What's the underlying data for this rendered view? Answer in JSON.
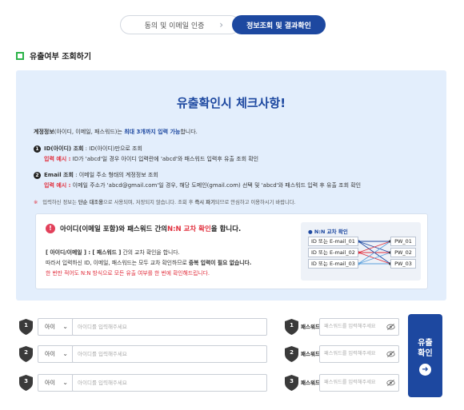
{
  "steps": {
    "step1_label": "동의 및 이메일 인증",
    "step2_label": "정보조회 및 결과확인"
  },
  "section": {
    "title": "유출여부 조회하기"
  },
  "panel": {
    "title": "유출확인시 체크사항!",
    "account_line": {
      "prefix": "계정정보",
      "mid": "(아이디, 이메일, 패스워드)는 ",
      "highlight": "최대 3개까지 입력 가능",
      "suffix": "합니다."
    },
    "id_lookup": {
      "num": "1",
      "title": "ID(아이디) 조회",
      "desc": " : ID(아이디)만으로 조회",
      "example_label": "입력 예시 :",
      "example_text": " ID가 'abcd'일 경우 아이디 입력란에 'abcd'와 패스워드 입력후 유출 조회 확인"
    },
    "email_lookup": {
      "num": "2",
      "title": "Email 조회",
      "desc": " : 이메일 주소 형태의 계정정보 조회",
      "example_label": "입력 예시 :",
      "example_text": " 이메일 주소가 'abcd@gmail.com'일 경우, 해당 도메인(gmail.com) 선택 및 'abcd'와 패스워드 입력 후 유출 조회 확인"
    },
    "notice": {
      "mark": "※",
      "text1": " 입력하신 정보는 ",
      "bold1": "단순 대조용",
      "text2": "으로 사용되며, 저장되지 않습니다. 조회 후 ",
      "bold2": "즉시 파기",
      "text3": "되므로 안심하고 이용하시기 바랍니다."
    },
    "cross": {
      "icon": "!",
      "head_a": "아이디(이메일 포함)",
      "head_b": "와 패스워드 간의 ",
      "head_red": "N:N 교차 확인",
      "head_c": "을 합니다.",
      "line1": "[ 아이디/이메일 ] : [ 패스워드 ]",
      "line1_tail": " 간의 교차 확인을 합니다.",
      "line2_a": "따라서 입력하신 ID, 이메일, 패스워드는 모두 교차 확인하므로 ",
      "line2_b": "중복 입력이 필요 없습니다.",
      "line3": "한 번만 적어도 N:N 방식으로 모든 유출 여부를 한 번에 확인해드립니다."
    },
    "diagram": {
      "title": "● N:N 교차 확인",
      "ids": [
        "ID 또는 E-mail_01",
        "ID 또는 E-mail_02",
        "ID 또는 E-mail_03"
      ],
      "pws": [
        "PW_01",
        "PW_02",
        "PW_03"
      ]
    }
  },
  "rows": [
    {
      "num": "1",
      "domain": "아이",
      "id_placeholder": "아이디를 입력해주세요",
      "pw_label": "패스워드",
      "pw_placeholder": "패스워드를 입력해주세요"
    },
    {
      "num": "2",
      "domain": "아이",
      "id_placeholder": "아이디를 입력해주세요",
      "pw_label": "패스워드",
      "pw_placeholder": "패스워드를 입력해주세요"
    },
    {
      "num": "3",
      "domain": "아이",
      "id_placeholder": "아이디를 입력해주세요",
      "pw_label": "패스워드",
      "pw_placeholder": "패스워드를 입력해주세요"
    }
  ],
  "submit": {
    "line1": "유출",
    "line2": "확인",
    "arrow": "➜"
  },
  "colors": {
    "primary": "#1d48a0",
    "accent_red": "#e12e3c",
    "panel_bg": "#e3eefc",
    "green": "#2db34a"
  }
}
